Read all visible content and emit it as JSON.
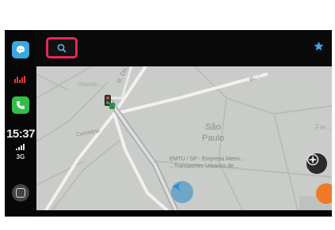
{
  "status": {
    "time": "15:37",
    "network": "3G"
  },
  "map": {
    "labels": {
      "sao_paulo_line1": "São",
      "sao_paulo_line2": "Paulo",
      "place_detail": "EMTU / SP - Empresa Metro...",
      "place_detail_2": "...Transportes Urbanos de...",
      "area": "Cemitério",
      "road_1": "R. Do...",
      "road_2": "R. ...",
      "district": "Fre...",
      "area_2": "Orlando..."
    }
  },
  "icons": {
    "waze": "waze-icon",
    "music": "music-bars-icon",
    "phone": "phone-icon",
    "home": "home-icon",
    "search": "search-icon",
    "star": "star-icon",
    "nav_arrow": "navigation-arrow-icon",
    "compass": "compass-icon",
    "report": "report-icon"
  },
  "colors": {
    "search_highlight": "#e8265a",
    "accent_blue": "#3da6e6",
    "phone_green": "#2fbf46",
    "report_orange": "#f07a25"
  }
}
